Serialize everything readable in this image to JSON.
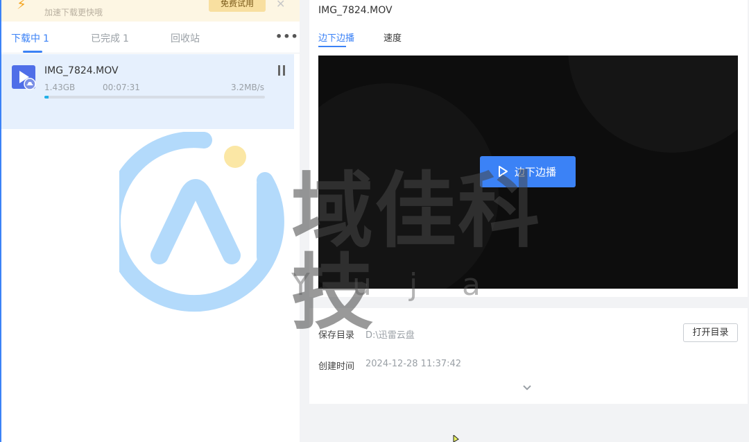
{
  "promo": {
    "text": "加速下载更快哦",
    "trial_label": "免费试用",
    "close_glyph": "✕"
  },
  "tabs": [
    {
      "label": "下载中",
      "count": "1"
    },
    {
      "label": "已完成",
      "count": "1"
    },
    {
      "label": "回收站",
      "count": ""
    }
  ],
  "more_glyph": "•••",
  "task": {
    "name": "IMG_7824.MOV",
    "size": "1.43GB",
    "remaining": "00:07:31",
    "speed": "3.2MB/s",
    "progress_percent": 2
  },
  "detail": {
    "file_title": "IMG_7824.MOV",
    "tabs": [
      "边下边播",
      "速度"
    ],
    "play_label": "边下边播",
    "save_dir_label": "保存目录",
    "save_dir_value": "D:\\迅雷云盘",
    "open_dir_label": "打开目录",
    "created_label": "创建时间",
    "created_value": "2024-12-28 11:37:42"
  },
  "watermark": {
    "text": "域佳科技",
    "latin": [
      "Y",
      "u",
      "j",
      "a"
    ]
  },
  "colors": {
    "accent": "#3b82f6",
    "progress": "#22b0e8",
    "selected_row": "#e6f0fd",
    "promo_bg": "#fdf6e3"
  }
}
